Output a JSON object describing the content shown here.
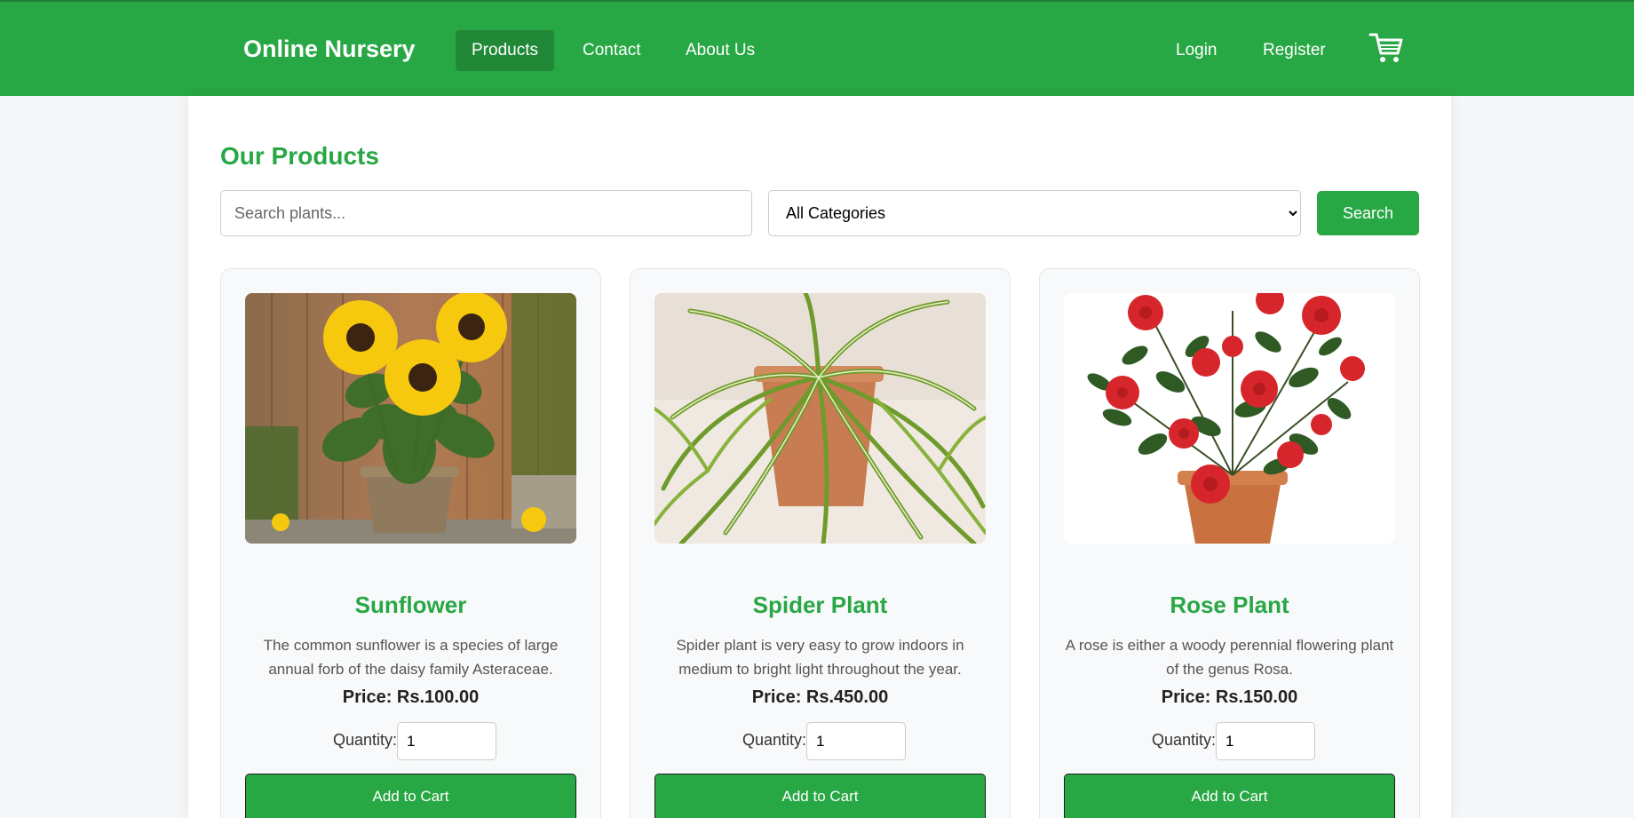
{
  "navbar": {
    "brand": "Online Nursery",
    "links": [
      {
        "label": "Products",
        "active": true
      },
      {
        "label": "Contact",
        "active": false
      },
      {
        "label": "About Us",
        "active": false
      }
    ],
    "auth": {
      "login": "Login",
      "register": "Register"
    },
    "cart_icon": "shopping-cart-icon"
  },
  "main": {
    "title": "Our Products",
    "search": {
      "placeholder": "Search plants...",
      "value": ""
    },
    "category": {
      "selected": "All Categories"
    },
    "search_button": "Search"
  },
  "products": [
    {
      "name": "Sunflower",
      "description": "The common sunflower is a species of large annual forb of the daisy family Asteraceae.",
      "price": "Price: Rs.100.00",
      "quantity_label": "Quantity:",
      "quantity": "1",
      "button": "Add to Cart"
    },
    {
      "name": "Spider Plant",
      "description": "Spider plant is very easy to grow indoors in medium to bright light throughout the year.",
      "price": "Price: Rs.450.00",
      "quantity_label": "Quantity:",
      "quantity": "1",
      "button": "Add to Cart"
    },
    {
      "name": "Rose Plant",
      "description": "A rose is either a woody perennial flowering plant of the genus Rosa.",
      "price": "Price: Rs.150.00",
      "quantity_label": "Quantity:",
      "quantity": "1",
      "button": "Add to Cart"
    }
  ],
  "colors": {
    "accent": "#28a745",
    "accent_dark": "#218838",
    "background": "#f4f6f8"
  }
}
